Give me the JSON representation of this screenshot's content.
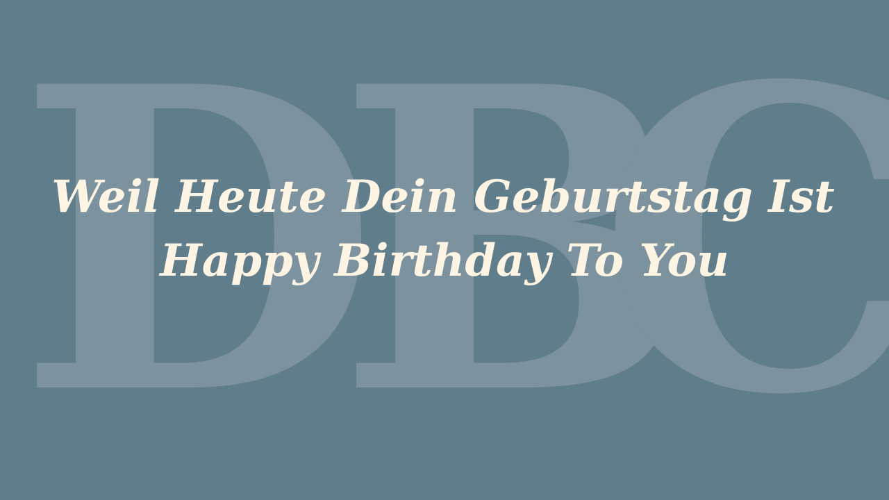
{
  "background_color": "#607d8b",
  "watermark": {
    "letters": [
      "D",
      "B",
      "C"
    ],
    "color": "#7c929e"
  },
  "greeting": {
    "line1": "Weil Heute Dein Geburtstag Ist",
    "line2": "Happy Birthday To You",
    "color": "#fdf4e4"
  }
}
